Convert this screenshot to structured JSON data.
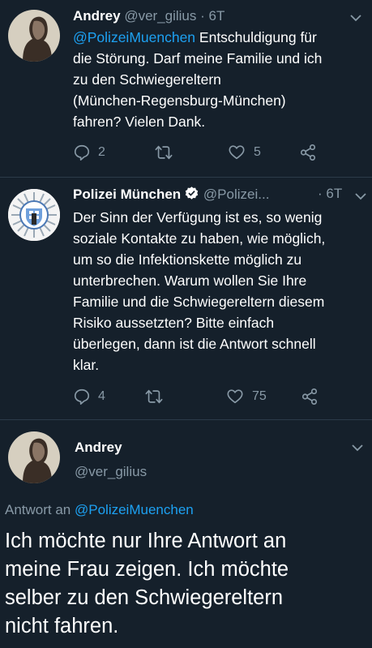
{
  "tweet1": {
    "name": "Andrey",
    "handle": "@ver_gilius",
    "time": "· 6T",
    "mention": "@PolizeiMuenchen",
    "text_line1_rest": " Entschuldigung für",
    "text_line2": "die Störung. Darf meine Familie und ich",
    "text_line3": "zu den Schwiegereltern",
    "text_line4": "(München-Regensburg-München)",
    "text_line5": "fahren? Vielen Dank.",
    "reply_count": "2",
    "retweet_count": "",
    "like_count": "5"
  },
  "tweet2": {
    "name": "Polizei München",
    "handle": "@Polizei...",
    "time": "· 6T",
    "lines": [
      "Der Sinn der Verfügung ist es, so wenig",
      "soziale Kontakte zu haben, wie möglich,",
      "um so die Infektionskette möglich zu",
      "unterbrechen. Warum wollen Sie Ihre",
      "Familie und die Schwiegereltern diesem",
      "Risiko aussetzten? Bitte einfach",
      "überlegen, dann ist die Antwort schnell",
      "klar."
    ],
    "reply_count": "4",
    "retweet_count": "",
    "like_count": "75"
  },
  "tweet3": {
    "name": "Andrey",
    "handle": "@ver_gilius",
    "reply_prefix": "Antwort an ",
    "reply_to": "@PolizeiMuenchen",
    "lines": [
      "Ich möchte nur Ihre Antwort an",
      "meine Frau zeigen. Ich möchte",
      "selber zu den Schwiegereltern",
      "nicht fahren."
    ]
  },
  "colors": {
    "background": "#15202b",
    "text": "#ffffff",
    "muted": "#8899a6",
    "link": "#1da1f2",
    "verified": "#ffffff"
  },
  "icons": [
    "reply-icon",
    "retweet-icon",
    "like-icon",
    "share-icon",
    "chevron-down-icon",
    "verified-badge-icon"
  ]
}
